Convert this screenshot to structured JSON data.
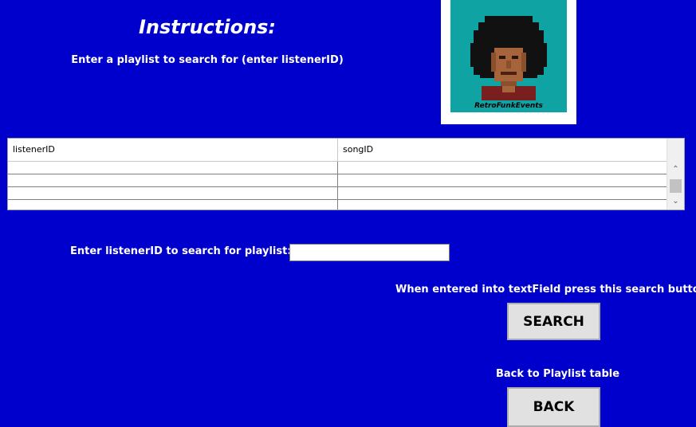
{
  "header": {
    "title": "Instructions:",
    "subtitle": "Enter a playlist to search for (enter listenerID)"
  },
  "logo": {
    "text": "RetroFunkEvents",
    "icon": "afro-character-icon",
    "background_color": "#0fa3a3"
  },
  "table": {
    "columns": [
      "listenerID",
      "songID"
    ],
    "rows": [
      [
        "",
        ""
      ],
      [
        "",
        ""
      ],
      [
        "",
        ""
      ],
      [
        "",
        ""
      ]
    ]
  },
  "search_form": {
    "label": "Enter listenerID to search for playlist:",
    "input_value": "",
    "hint": "When entered into textField press this search button",
    "search_button_label": "SEARCH"
  },
  "back": {
    "label": "Back to Playlist table",
    "button_label": "BACK"
  },
  "colors": {
    "background": "#0000cc",
    "text": "#ffffff",
    "button": "#e1e1e1"
  }
}
